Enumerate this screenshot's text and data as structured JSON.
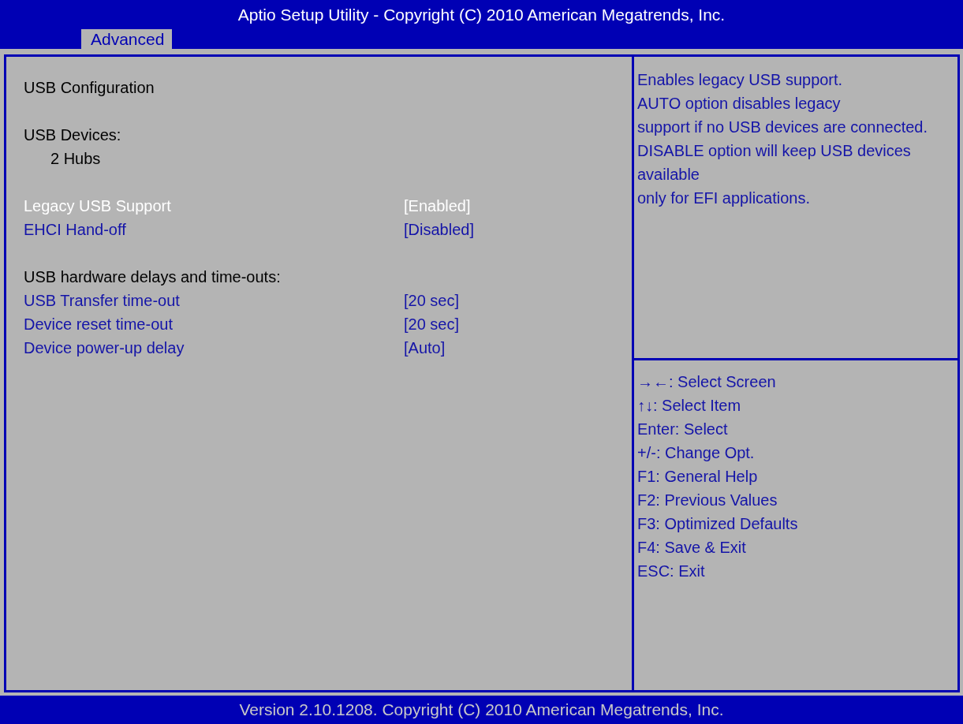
{
  "window": {
    "title": "Aptio Setup Utility - Copyright (C) 2010 American Megatrends, Inc."
  },
  "tabs": [
    {
      "label": "Advanced",
      "selected": true
    }
  ],
  "items": [
    {
      "kind": "text",
      "label": "USB Configuration"
    },
    {
      "kind": "blank"
    },
    {
      "kind": "text",
      "label": "USB Devices:"
    },
    {
      "kind": "subtext",
      "label": "2 Hubs"
    },
    {
      "kind": "blank"
    },
    {
      "kind": "setting",
      "label": "Legacy USB Support",
      "value": "[Enabled]",
      "selected": true
    },
    {
      "kind": "setting",
      "label": "EHCI Hand-off",
      "value": "[Disabled]",
      "selected": false
    },
    {
      "kind": "blank"
    },
    {
      "kind": "text",
      "label": "USB hardware delays and time-outs:"
    },
    {
      "kind": "setting",
      "label": "USB Transfer time-out",
      "value": "[20 sec]",
      "selected": false
    },
    {
      "kind": "setting",
      "label": "Device reset time-out",
      "value": "[20 sec]",
      "selected": false
    },
    {
      "kind": "setting",
      "label": "Device power-up delay",
      "value": "[Auto]",
      "selected": false
    }
  ],
  "help": [
    "Enables legacy USB support.",
    "AUTO option disables legacy",
    "support if no USB devices are connected.",
    "DISABLE option will keep USB devices",
    "available",
    "only for EFI applications."
  ],
  "keys": [
    "→←: Select Screen",
    "↑↓: Select Item",
    "Enter: Select",
    "+/-: Change Opt.",
    "F1: General Help",
    "F2: Previous Values",
    "F3: Optimized Defaults",
    "F4: Save & Exit",
    "ESC: Exit"
  ],
  "status_bar": "Version 2.10.1208. Copyright (C) 2010 American Megatrends, Inc."
}
